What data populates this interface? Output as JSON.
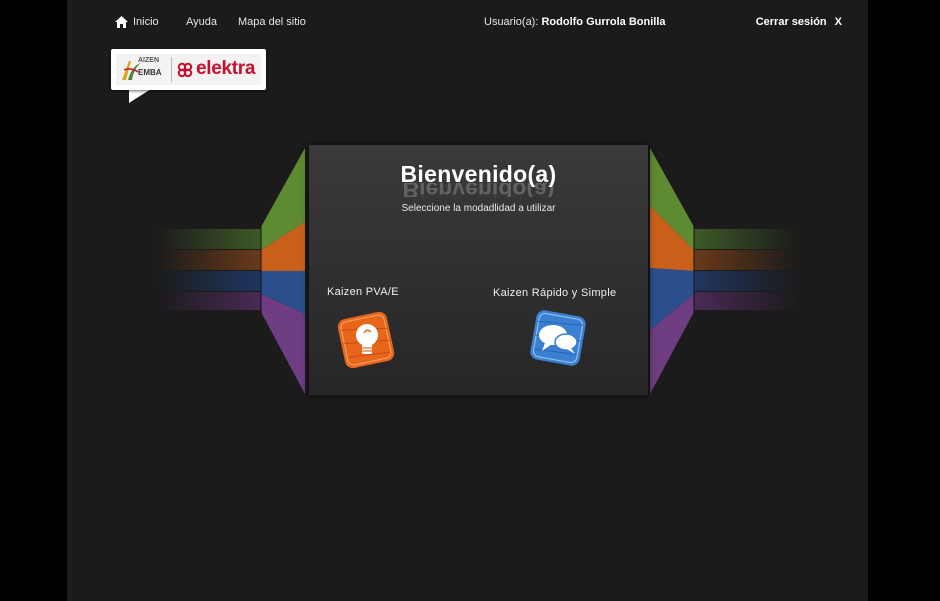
{
  "nav": {
    "home_label": "Inicio",
    "help_label": "Ayuda",
    "sitemap_label": "Mapa del sitio",
    "user_prefix": "Usuario(a):",
    "user_name": "Rodolfo Gurrola Bonilla",
    "logout_label": "Cerrar sesión",
    "logout_x": "X"
  },
  "logo": {
    "kaizen_line1": "AIZEN",
    "kaizen_line2": "EMBA",
    "brand": "elektra"
  },
  "panel": {
    "title": "Bienvenido(a)",
    "subtitle": "Seleccione la modadlidad a utilizar",
    "options": [
      {
        "label": "Kaizen PVA/E",
        "icon": "lightbulb-icon",
        "color": "#e8661c"
      },
      {
        "label": "Kaizen Rápido y Simple",
        "icon": "chat-bubbles-icon",
        "color": "#3a7fd0"
      }
    ]
  },
  "colors": {
    "background": "#1b1b1b",
    "green": "#5e8a32",
    "orange": "#c8601c",
    "blue": "#2a4f8c",
    "purple": "#6e3d82",
    "elektra_red": "#c8102e"
  }
}
